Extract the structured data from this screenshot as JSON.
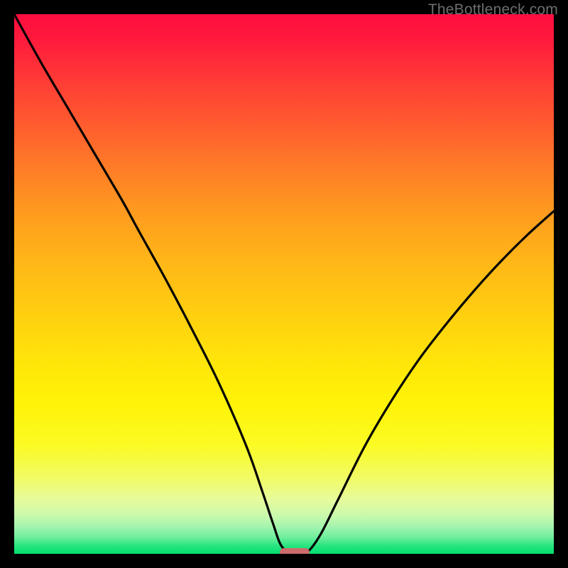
{
  "watermark": "TheBottleneck.com",
  "colors": {
    "frame": "#000000",
    "curve": "#000000",
    "marker": "#cc6c6c",
    "watermark": "#6e6e6e"
  },
  "chart_data": {
    "type": "line",
    "title": "",
    "xlabel": "",
    "ylabel": "",
    "xlim": [
      0,
      100
    ],
    "ylim": [
      0,
      100
    ],
    "x": [
      0,
      5,
      10,
      15,
      20,
      23,
      28,
      33,
      38,
      43,
      46,
      48,
      49.5,
      51.5,
      53.5,
      55,
      57,
      60,
      65,
      70,
      75,
      80,
      85,
      90,
      95,
      100
    ],
    "values": [
      100,
      91,
      82.5,
      74,
      65.5,
      60,
      51,
      41.5,
      31.5,
      20,
      11.5,
      5.5,
      1.5,
      0,
      0,
      1,
      4,
      10,
      20,
      28.5,
      36,
      42.5,
      48.5,
      54,
      59,
      63.5
    ],
    "marker_x": 52,
    "marker_w": 5.5,
    "annotations": []
  }
}
